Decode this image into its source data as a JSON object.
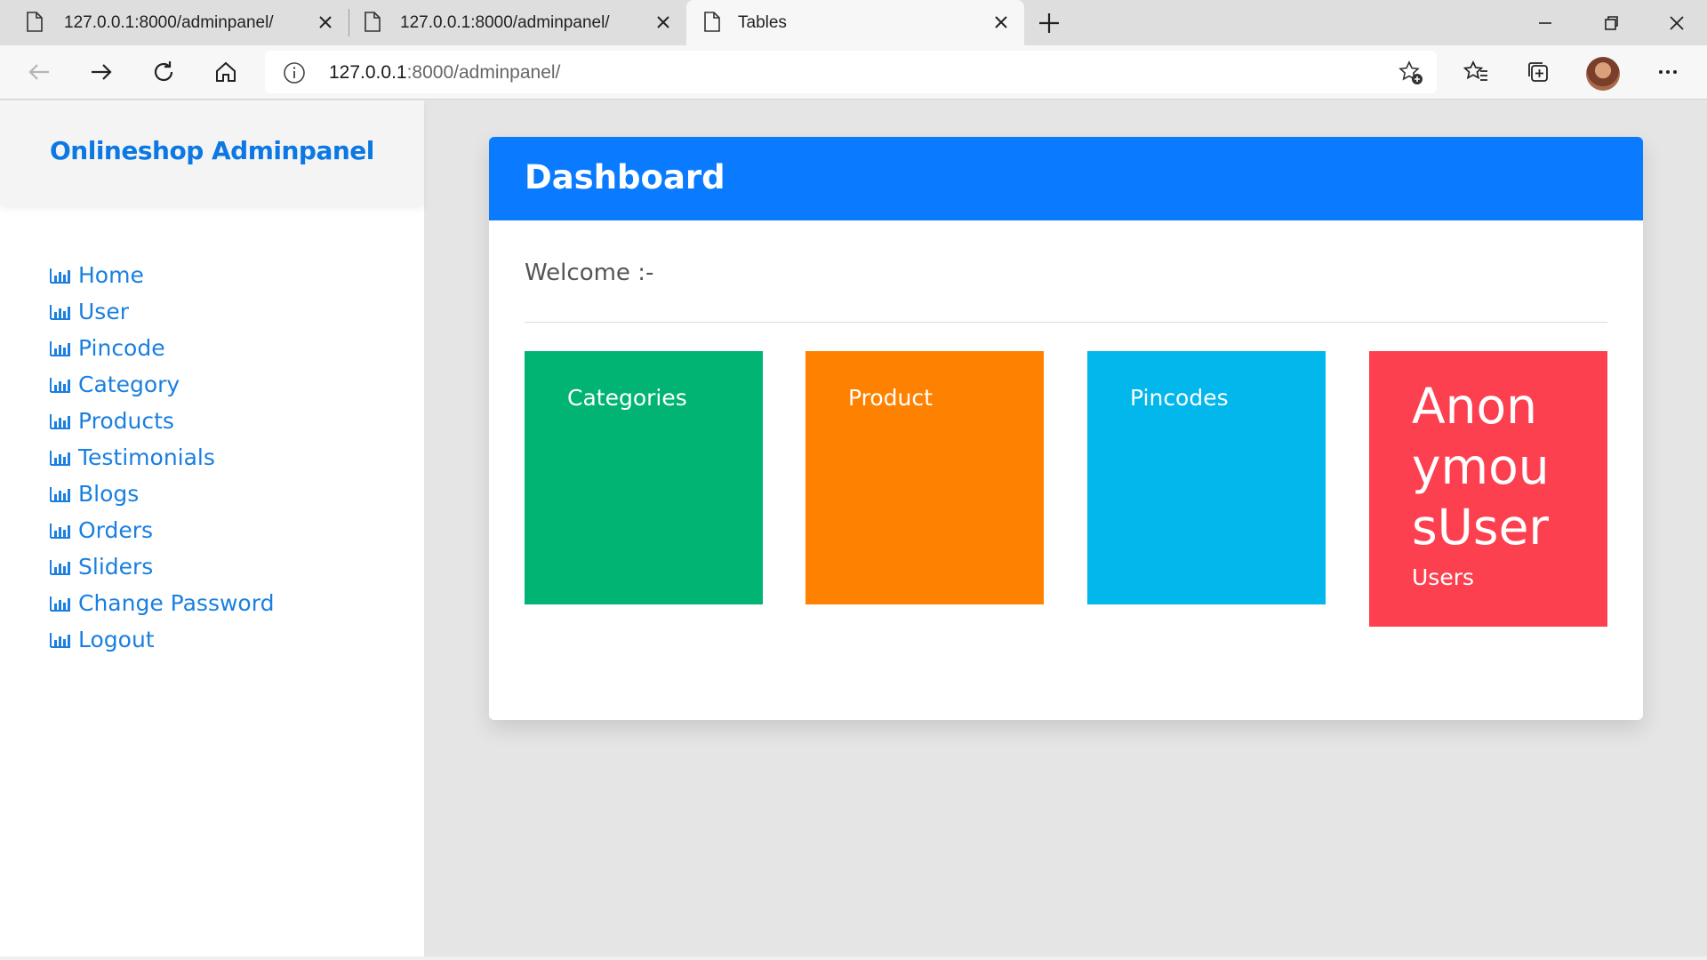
{
  "browser": {
    "tabs": [
      {
        "label": "127.0.0.1:8000/adminpanel/",
        "active": false
      },
      {
        "label": "127.0.0.1:8000/adminpanel/",
        "active": false
      },
      {
        "label": "Tables",
        "active": true
      }
    ],
    "address": {
      "host": "127.0.0.1",
      "rest": ":8000/adminpanel/"
    }
  },
  "sidebar": {
    "brand": "Onlineshop Adminpanel",
    "items": [
      {
        "label": "Home"
      },
      {
        "label": "User"
      },
      {
        "label": "Pincode"
      },
      {
        "label": "Category"
      },
      {
        "label": "Products"
      },
      {
        "label": "Testimonials"
      },
      {
        "label": "Blogs"
      },
      {
        "label": "Orders"
      },
      {
        "label": "Sliders"
      },
      {
        "label": "Change Password"
      },
      {
        "label": "Logout"
      }
    ]
  },
  "dashboard": {
    "title": "Dashboard",
    "welcome": "Welcome :-",
    "tiles": [
      {
        "label": "Categories",
        "color": "#02b474"
      },
      {
        "label": "Product",
        "color": "#fe8200"
      },
      {
        "label": "Pincodes",
        "color": "#01b7eb"
      },
      {
        "label": "Users",
        "value": "AnonymousUser",
        "color": "#fc4050"
      }
    ]
  },
  "colors": {
    "accent": "#0a7bfe",
    "link": "#1a7fe0"
  }
}
